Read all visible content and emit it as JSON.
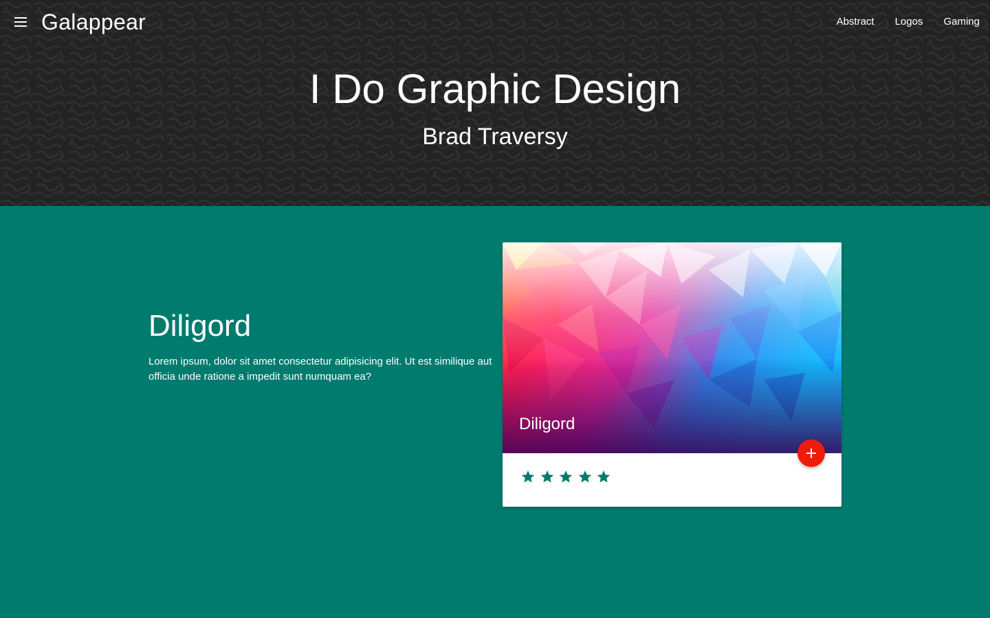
{
  "navbar": {
    "brand": "Galappear",
    "links": [
      "Abstract",
      "Logos",
      "Gaming"
    ]
  },
  "hero": {
    "title": "I Do Graphic Design",
    "subtitle": "Brad Traversy"
  },
  "project": {
    "title": "Diligord",
    "description": "Lorem ipsum, dolor sit amet consectetur adipisicing elit. Ut est similique aut officia unde ratione a impedit sunt numquam ea?"
  },
  "card": {
    "title": "Diligord",
    "rating": 5,
    "rating_max": 5
  },
  "icons": {
    "menu": "hamburger-menu-icon",
    "fab": "plus-icon",
    "rating": "star-icon"
  },
  "colors": {
    "hero_bg": "#232323",
    "main_bg": "#007b6e",
    "star": "#007b6e",
    "fab": "#f21b0b",
    "text": "#ffffff"
  }
}
